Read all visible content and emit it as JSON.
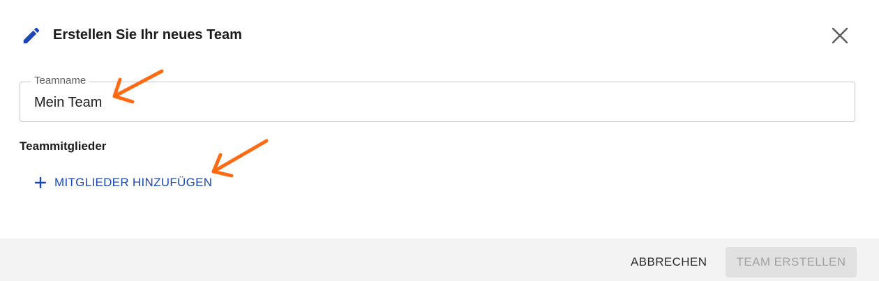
{
  "dialog": {
    "title": "Erstellen Sie Ihr neues Team",
    "icons": {
      "header": "pencil-icon",
      "close": "close-icon"
    },
    "accent_color": "#1a47b8"
  },
  "team_name_field": {
    "label": "Teamname",
    "value": "Mein Team"
  },
  "members": {
    "label": "Teammitglieder",
    "add_button_label": "MITGLIEDER HINZUFÜGEN",
    "add_icon": "plus-icon"
  },
  "footer": {
    "cancel_label": "ABBRECHEN",
    "create_label": "TEAM ERSTELLEN",
    "create_disabled": true
  },
  "annotations": {
    "arrow_color": "#ff6a13"
  }
}
